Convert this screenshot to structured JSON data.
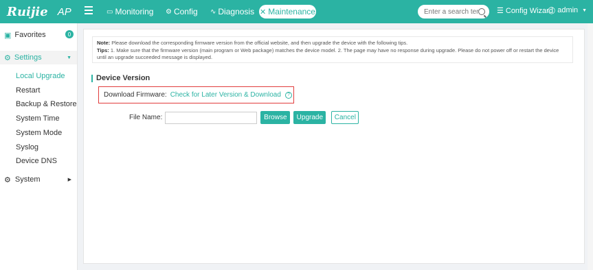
{
  "header": {
    "brand": "Ruijie",
    "product": "AP",
    "nav": [
      {
        "label": "Monitoring",
        "icon": "monitor-icon"
      },
      {
        "label": "Config",
        "icon": "gear-icon"
      },
      {
        "label": "Diagnosis",
        "icon": "diagnosis-icon"
      },
      {
        "label": "Maintenance",
        "icon": "wrench-icon"
      }
    ],
    "search_placeholder": "Enter a search term",
    "config_wizard": "Config Wizard",
    "user": "admin"
  },
  "sidebar": {
    "favorites": {
      "label": "Favorites",
      "count": "0"
    },
    "settings": {
      "label": "Settings"
    },
    "items": [
      {
        "label": "Local Upgrade"
      },
      {
        "label": "Restart"
      },
      {
        "label": "Backup & Restore"
      },
      {
        "label": "System Time"
      },
      {
        "label": "System Mode"
      },
      {
        "label": "Syslog"
      },
      {
        "label": "Device DNS"
      }
    ],
    "system": {
      "label": "System"
    }
  },
  "main": {
    "note_label": "Note:",
    "note_text": "Please download the corresponding firmware version from the official website, and then upgrade the device with the following tips.",
    "tips_label": "Tips:",
    "tips_text": "1. Make sure that the firmware version (main program or Web package) matches the device model. 2. The page may have no response during upgrade. Please do not power off or restart the device until an upgrade succeeded message is displayed.",
    "section_title": "Device Version",
    "download_label": "Download Firmware:",
    "download_link": "Check for Later Version & Download",
    "help_glyph": "?",
    "file_label": "File Name:",
    "file_value": "",
    "browse": "Browse",
    "upgrade": "Upgrade",
    "cancel": "Cancel"
  },
  "colors": {
    "accent": "#2bb3a3",
    "highlight": "#e13c3c"
  }
}
